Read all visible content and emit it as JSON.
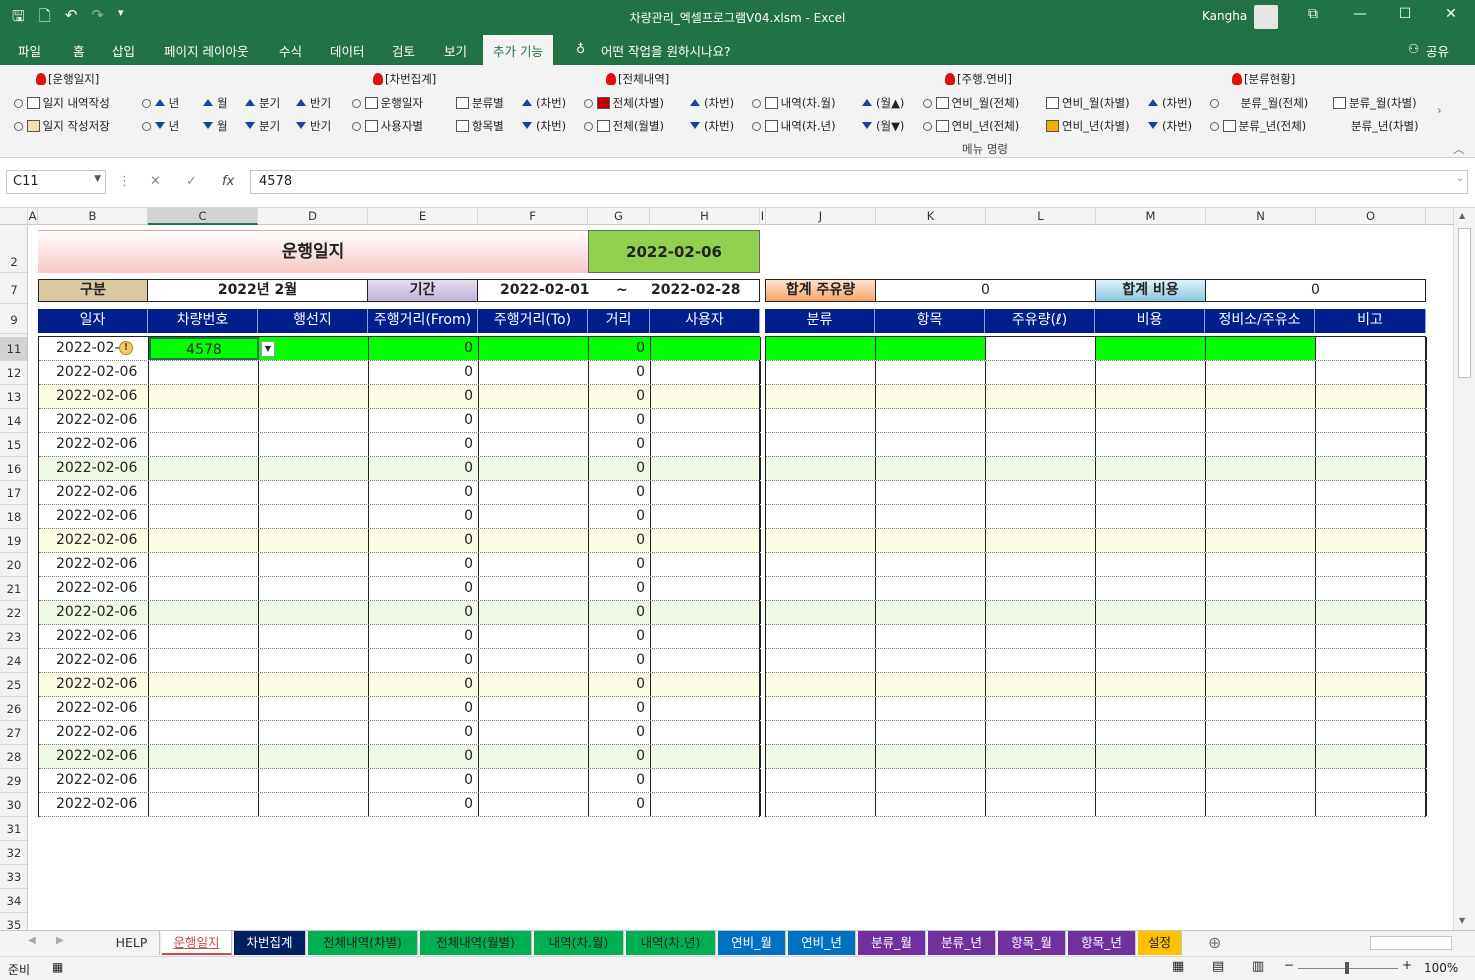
{
  "window": {
    "title": "차량관리_엑셀프로그램V04.xlsm  -  Excel",
    "user": "Kangha"
  },
  "menu": {
    "tabs": [
      "파일",
      "홈",
      "삽입",
      "페이지 레이아웃",
      "수식",
      "데이터",
      "검토",
      "보기",
      "추가 기능"
    ],
    "active": "추가 기능",
    "tellme": "어떤 작업을 원하시나요?",
    "share": "공유"
  },
  "ribbon": {
    "group_label": "메뉴 명령",
    "groups": {
      "g1": "[운행일지]",
      "g2": "[차번집계]",
      "g3": "[전체내역]",
      "g4": "[주행.연비]",
      "g5": "[분류현황]"
    },
    "row1": {
      "a": "일지 내역작성",
      "b1": "년",
      "b2": "월",
      "b3": "분기",
      "b4": "반기",
      "c1": "운행일자",
      "c2": "분류별",
      "c3": "(차번)",
      "d1": "전체(차별)",
      "d2": "(차번)",
      "d3": "내역(차.월)",
      "d4": "(월▲)",
      "e1": "연비_월(전체)",
      "e2": "연비_월(차별)",
      "e3": "(차번)",
      "f1": "분류_월(전체)",
      "f2": "분류_월(차별)"
    },
    "row2": {
      "a": "일지 작성저장",
      "b1": "년",
      "b2": "월",
      "b3": "분기",
      "b4": "반기",
      "c1": "사용자별",
      "c2": "항목별",
      "c3": "(차번)",
      "d1": "전체(월별)",
      "d2": "(차번)",
      "d3": "내역(차.년)",
      "d4": "(월▼)",
      "e1": "연비_년(전체)",
      "e2": "연비_년(차별)",
      "e3": "(차번)",
      "f1": "분류_년(전체)",
      "f2": "분류_년(차별)"
    }
  },
  "formula_bar": {
    "name_box": "C11",
    "value": "4578"
  },
  "columns": [
    "A",
    "B",
    "C",
    "D",
    "E",
    "F",
    "G",
    "H",
    "I",
    "J",
    "K",
    "L",
    "M",
    "N",
    "O"
  ],
  "rows": [
    "2",
    "7",
    "9",
    "11",
    "12",
    "13",
    "14",
    "15",
    "16",
    "17",
    "18",
    "19",
    "20",
    "21",
    "22",
    "23",
    "24",
    "25",
    "26",
    "27",
    "28",
    "29",
    "30",
    "31",
    "32",
    "33",
    "34",
    "35"
  ],
  "sheet": {
    "title": "운행일지",
    "date": "2022-02-06",
    "gubun_label": "구분",
    "gubun_value": "2022년 2월",
    "period_label": "기간",
    "period_from": "2022-02-01",
    "period_sep": "~",
    "period_to": "2022-02-28",
    "fuel_total_label": "합계 주유량",
    "fuel_total_value": "0",
    "cost_total_label": "합계 비용",
    "cost_total_value": "0",
    "left_headers": [
      "일자",
      "차량번호",
      "행선지",
      "주행거리(From)",
      "주행거리(To)",
      "거리",
      "사용자"
    ],
    "right_headers": [
      "분류",
      "항목",
      "주유량(ℓ)",
      "비용",
      "정비소/주유소",
      "비고"
    ],
    "first_row": {
      "date": "2022-02-",
      "car": "4578",
      "from": "0",
      "dist": "0"
    },
    "rows": [
      {
        "date": "2022-02-06",
        "from": "0",
        "dist": "0"
      },
      {
        "date": "2022-02-06",
        "from": "0",
        "dist": "0"
      },
      {
        "date": "2022-02-06",
        "from": "0",
        "dist": "0"
      },
      {
        "date": "2022-02-06",
        "from": "0",
        "dist": "0"
      },
      {
        "date": "2022-02-06",
        "from": "0",
        "dist": "0"
      },
      {
        "date": "2022-02-06",
        "from": "0",
        "dist": "0"
      },
      {
        "date": "2022-02-06",
        "from": "0",
        "dist": "0"
      },
      {
        "date": "2022-02-06",
        "from": "0",
        "dist": "0"
      },
      {
        "date": "2022-02-06",
        "from": "0",
        "dist": "0"
      },
      {
        "date": "2022-02-06",
        "from": "0",
        "dist": "0"
      },
      {
        "date": "2022-02-06",
        "from": "0",
        "dist": "0"
      },
      {
        "date": "2022-02-06",
        "from": "0",
        "dist": "0"
      },
      {
        "date": "2022-02-06",
        "from": "0",
        "dist": "0"
      },
      {
        "date": "2022-02-06",
        "from": "0",
        "dist": "0"
      },
      {
        "date": "2022-02-06",
        "from": "0",
        "dist": "0"
      },
      {
        "date": "2022-02-06",
        "from": "0",
        "dist": "0"
      },
      {
        "date": "2022-02-06",
        "from": "0",
        "dist": "0"
      },
      {
        "date": "2022-02-06",
        "from": "0",
        "dist": "0"
      },
      {
        "date": "2022-02-06",
        "from": "0",
        "dist": "0"
      }
    ]
  },
  "sheet_tabs": [
    {
      "label": "HELP",
      "bg": "#f3f3f3",
      "fg": "#333"
    },
    {
      "label": "운행일지",
      "bg": "#ffffff",
      "fg": "#c0504d"
    },
    {
      "label": "차번집계",
      "bg": "#002060",
      "fg": "#ffffff"
    },
    {
      "label": "전체내역(차별)",
      "bg": "#00b050",
      "fg": "#222"
    },
    {
      "label": "전체내역(월별)",
      "bg": "#00b050",
      "fg": "#222"
    },
    {
      "label": "내역(차.월)",
      "bg": "#00b050",
      "fg": "#222"
    },
    {
      "label": "내역(차.년)",
      "bg": "#00b050",
      "fg": "#222"
    },
    {
      "label": "연비_월",
      "bg": "#0070c0",
      "fg": "#ffffff"
    },
    {
      "label": "연비_년",
      "bg": "#0070c0",
      "fg": "#ffffff"
    },
    {
      "label": "분류_월",
      "bg": "#7030a0",
      "fg": "#ffffff"
    },
    {
      "label": "분류_년",
      "bg": "#7030a0",
      "fg": "#ffffff"
    },
    {
      "label": "항목_월",
      "bg": "#7030a0",
      "fg": "#ffffff"
    },
    {
      "label": "항목_년",
      "bg": "#7030a0",
      "fg": "#ffffff"
    },
    {
      "label": "설정",
      "bg": "#ffc000",
      "fg": "#222"
    }
  ],
  "status": {
    "ready": "준비",
    "zoom": "100%"
  },
  "colors": {
    "excel_green": "#217346",
    "header_navy": "#001e8c",
    "row_yellow": "#fdfde4",
    "row_green": "#eff7e6",
    "bright_green": "#00ff00",
    "date_green": "#92d050"
  }
}
